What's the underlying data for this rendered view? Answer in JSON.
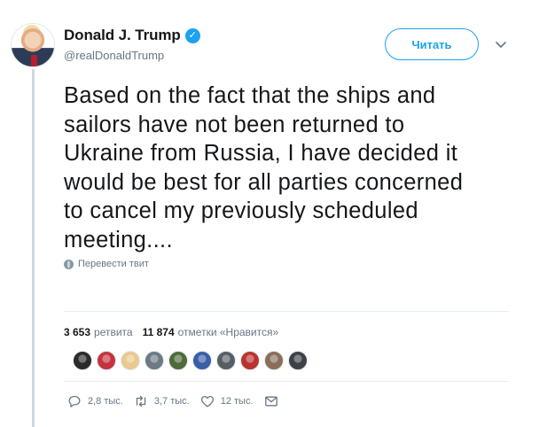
{
  "tweet": {
    "author": {
      "display_name": "Donald J. Trump",
      "handle": "@realDonaldTrump",
      "verified": true
    },
    "follow_button_label": "Читать",
    "text_lines": [
      "Based on the fact that the ships and",
      "sailors have not been returned to",
      "Ukraine from Russia, I have decided it",
      "would be best for all parties concerned",
      "to cancel my previously scheduled",
      "meeting...."
    ],
    "translate_label": "Перевести твит",
    "stats": {
      "retweets_count": "3 653",
      "retweets_label": "ретвита",
      "likes_count": "11 874",
      "likes_label": "отметки «Нравится»"
    },
    "liker_avatar_colors": [
      "#2b2b2b",
      "#c3343f",
      "#e8c98e",
      "#6d7a84",
      "#4f6b3a",
      "#3b5ea8",
      "#585e66",
      "#b8342f",
      "#8a6e5a",
      "#3e4148"
    ],
    "actions": {
      "replies_count": "2,8 тыс.",
      "retweets_count": "3,7 тыс.",
      "likes_count": "12 тыс."
    },
    "accent_color": "#1da1f2"
  }
}
